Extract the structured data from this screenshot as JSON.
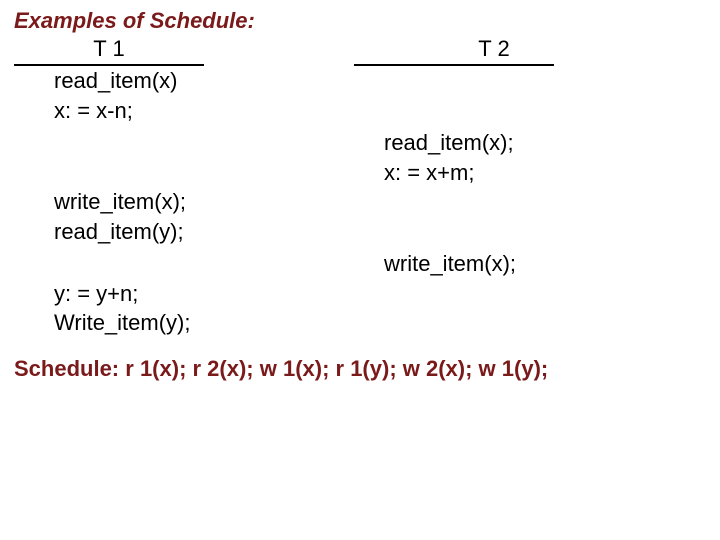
{
  "title": "Examples of Schedule:",
  "headers": {
    "t1": "T 1",
    "t2": "T 2"
  },
  "t1": {
    "b1l1": "read_item(x)",
    "b1l2": "x: = x-n;",
    "b2l1": "write_item(x);",
    "b2l2": "read_item(y);",
    "b3l1": "y: = y+n;",
    "b3l2": "Write_item(y);"
  },
  "t2": {
    "b1l1": "read_item(x);",
    "b1l2": "x: = x+m;",
    "b2l1": "write_item(x);"
  },
  "schedule": {
    "label": "Schedule:",
    "seq": "r 1(x); r 2(x); w 1(x); r 1(y); w 2(x); w 1(y);"
  }
}
